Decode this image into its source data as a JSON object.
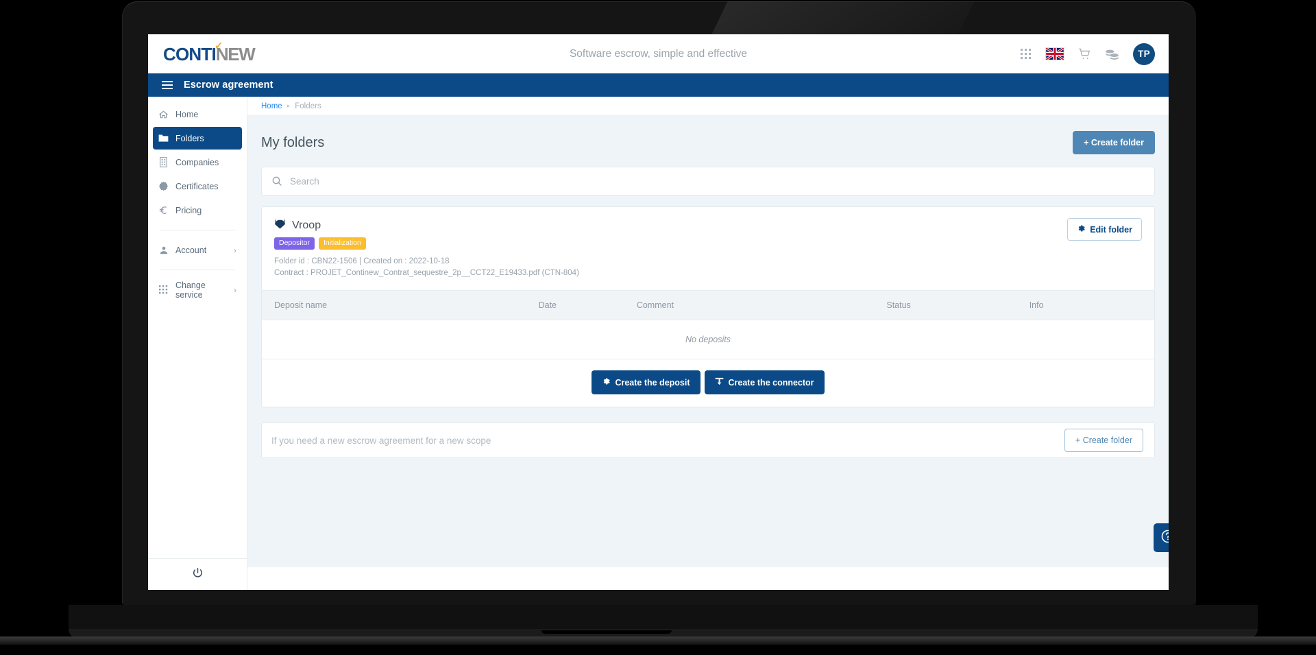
{
  "topbar": {
    "logo_primary": "CONTI",
    "logo_secondary": "NEW",
    "tagline": "Software escrow, simple and effective",
    "icons": [
      "apps-grid-icon",
      "uk-flag-icon",
      "shopping-cart-icon",
      "coins-icon"
    ],
    "avatar_initials": "TP"
  },
  "appbar": {
    "title": "Escrow agreement",
    "menu_icon": "hamburger-menu-icon"
  },
  "sidebar": {
    "items": [
      {
        "label": "Home",
        "icon": "home-icon",
        "active": false,
        "chevron": false
      },
      {
        "label": "Folders",
        "icon": "folder-icon",
        "active": true,
        "chevron": false
      },
      {
        "label": "Companies",
        "icon": "building-icon",
        "active": false,
        "chevron": false
      },
      {
        "label": "Certificates",
        "icon": "certificate-seal-icon",
        "active": false,
        "chevron": false
      },
      {
        "label": "Pricing",
        "icon": "euro-icon",
        "active": false,
        "chevron": false
      },
      {
        "label": "Account",
        "icon": "user-icon",
        "active": false,
        "chevron": true
      },
      {
        "label": "Change service",
        "icon": "grid-icon",
        "active": false,
        "chevron": true
      }
    ],
    "logout_icon": "power-icon"
  },
  "breadcrumb": {
    "home": "Home",
    "separator": "▸",
    "current": "Folders"
  },
  "page": {
    "title": "My folders",
    "create_folder_label": "+ Create folder"
  },
  "search": {
    "placeholder": "Search",
    "value": "",
    "icon": "search-icon"
  },
  "folder": {
    "icon": "wolf-head-icon",
    "name": "Vroop",
    "badges": [
      {
        "label": "Depositor",
        "color": "#7d64e8"
      },
      {
        "label": "Initialization",
        "color": "#fcbe2c"
      }
    ],
    "meta_line1": "Folder id : CBN22-1506 | Created on : 2022-10-18",
    "meta_line2": "Contract : PROJET_Continew_Contrat_sequestre_2p__CCT22_E19433.pdf (CTN-804)",
    "edit_label": "Edit folder",
    "edit_icon": "gear-icon"
  },
  "table": {
    "columns": [
      "Deposit name",
      "Date",
      "Comment",
      "Status",
      "Info"
    ],
    "rows": [],
    "empty_message": "No deposits"
  },
  "card_actions": [
    {
      "label": "Create the deposit",
      "icon": "gear-icon"
    },
    {
      "label": "Create the connector",
      "icon": "connector-icon"
    }
  ],
  "cta": {
    "text": "If you need a new escrow agreement for a new scope",
    "button_label": "+ Create folder"
  },
  "help": {
    "icon": "question-mark-icon",
    "label": "?"
  },
  "colors": {
    "navy": "#0b4a87",
    "steel": "#4e87b5",
    "page_bg": "#eef4f7",
    "link": "#2d8cf0",
    "badge_purple": "#7d64e8",
    "badge_amber": "#fcbe2c"
  }
}
